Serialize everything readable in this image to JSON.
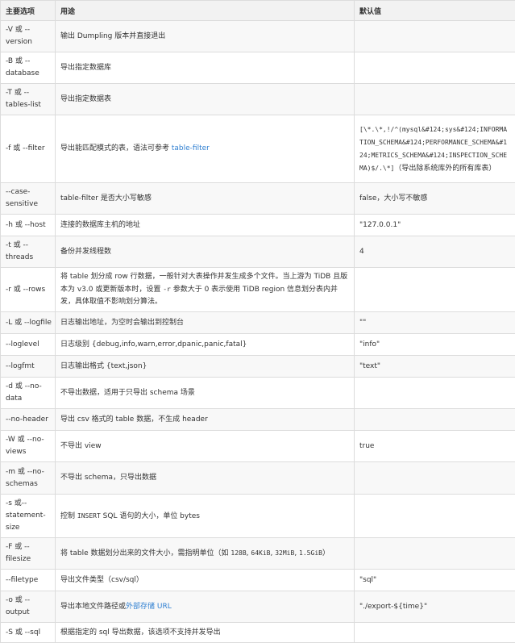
{
  "headers": [
    "主要选项",
    "用途",
    "默认值"
  ],
  "rows": [
    {
      "option": "-V 或 --version",
      "usage": [
        "输出 Dumpling 版本并直接退出"
      ],
      "default": ""
    },
    {
      "option": "-B 或 --database",
      "usage": [
        "导出指定数据库"
      ],
      "default": ""
    },
    {
      "option": "-T 或 --tables-list",
      "usage": [
        "导出指定数据表"
      ],
      "default": ""
    },
    {
      "option": "-f 或 --filter",
      "usage": [
        "导出能匹配模式的表，语法可参考 ",
        {
          "link": "table-filter"
        }
      ],
      "default": [
        {
          "code": "[\\*.\\*,!/^(mysql&#124;sys&#124;INFORMATION_SCHEMA&#124;PERFORMANCE_SCHEMA&#124;METRICS_SCHEMA&#124;INSPECTION_SCHEMA)$/.\\*]"
        },
        "（导出除系统库外的所有库表）"
      ]
    },
    {
      "option": "--case-sensitive",
      "usage": [
        "table-filter 是否大小写敏感"
      ],
      "default": "false，大小写不敏感"
    },
    {
      "option": "-h 或 --host",
      "usage": [
        "连接的数据库主机的地址"
      ],
      "default": "\"127.0.0.1\""
    },
    {
      "option": "-t 或 --threads",
      "usage": [
        "备份并发线程数"
      ],
      "default": "4"
    },
    {
      "option": "-r 或 --rows",
      "usage": [
        "将 table 划分成 row 行数据，一般针对大表操作并发生成多个文件。当上游为 TiDB 且版本为 v3.0 或更新版本时，设置 ",
        {
          "code": "-r"
        },
        " 参数大于 0 表示使用 TiDB region 信息划分表内并发，具体取值不影响划分算法。"
      ],
      "default": ""
    },
    {
      "option": "-L 或 --logfile",
      "usage": [
        "日志输出地址，为空时会输出到控制台"
      ],
      "default": "\"\""
    },
    {
      "option": "--loglevel",
      "usage": [
        "日志级别 {debug,info,warn,error,dpanic,panic,fatal}"
      ],
      "default": "\"info\""
    },
    {
      "option": "--logfmt",
      "usage": [
        "日志输出格式 {text,json}"
      ],
      "default": "\"text\""
    },
    {
      "option": "-d 或 --no-data",
      "usage": [
        "不导出数据，适用于只导出 schema 场景"
      ],
      "default": ""
    },
    {
      "option": "--no-header",
      "usage": [
        "导出 csv 格式的 table 数据，不生成 header"
      ],
      "default": ""
    },
    {
      "option": "-W 或 --no-views",
      "usage": [
        "不导出 view"
      ],
      "default": "true"
    },
    {
      "option": "-m 或 --no-schemas",
      "usage": [
        "不导出 schema，只导出数据"
      ],
      "default": ""
    },
    {
      "option": "-s 或--statement-size",
      "usage": [
        "控制 ",
        {
          "code": "INSERT"
        },
        " SQL 语句的大小，单位 bytes"
      ],
      "default": ""
    },
    {
      "option": "-F 或 --filesize",
      "usage": [
        "将 table 数据划分出来的文件大小，需指明单位（如 ",
        {
          "code": "128B"
        },
        ", ",
        {
          "code": "64KiB"
        },
        ", ",
        {
          "code": "32MiB"
        },
        ", ",
        {
          "code": "1.5GiB"
        },
        "）"
      ],
      "default": ""
    },
    {
      "option": "--filetype",
      "usage": [
        "导出文件类型（csv/sql）"
      ],
      "default": "\"sql\""
    },
    {
      "option": "-o 或 --output",
      "usage": [
        "导出本地文件路径或",
        {
          "link": "外部存储 URL"
        }
      ],
      "default": "\"./export-${time}\""
    },
    {
      "option": "-S 或 --sql",
      "usage": [
        "根据指定的 sql 导出数据，该选项不支持并发导出"
      ],
      "default": ""
    }
  ]
}
